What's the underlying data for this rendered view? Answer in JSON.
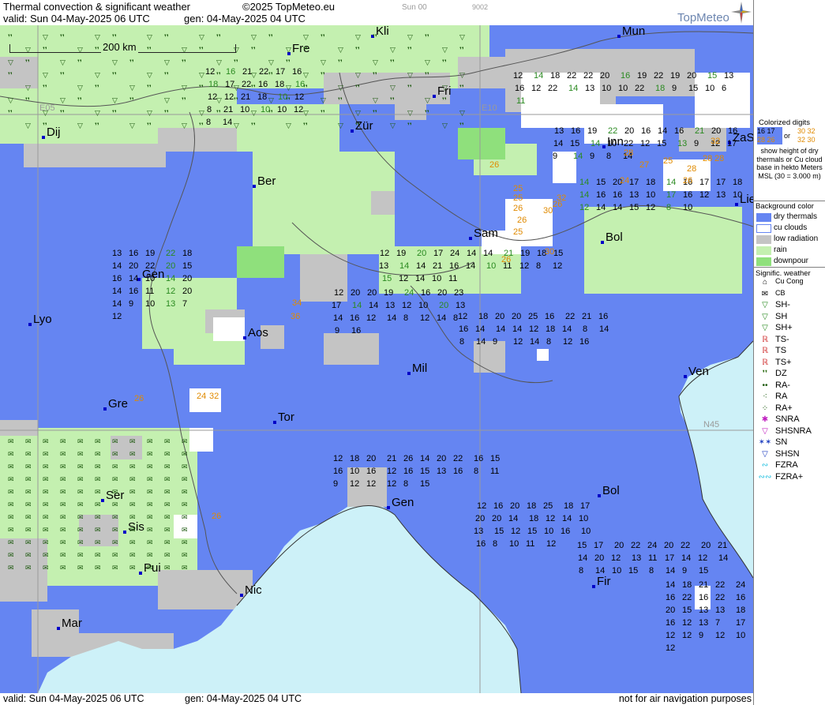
{
  "header": {
    "title": "Thermal convection & significant weather",
    "copyright": "©2025 TopMeteo.eu",
    "valid": "valid:  Sun  04-May-2025  06 UTC",
    "gen": "gen:  04-May-2025  04 UTC",
    "small_tag": "Sun 00",
    "small_code": "9002",
    "logo": "TopMeteo"
  },
  "footer": {
    "valid": "valid:  Sun  04-May-2025  06 UTC",
    "gen": "gen:  04-May-2025  04 UTC",
    "disclaimer": "not for air navigation purposes"
  },
  "map": {
    "scale_label": "200 km",
    "grid_labels": [
      {
        "id": "e05",
        "text": "E05"
      },
      {
        "id": "e10",
        "text": "E10"
      },
      {
        "id": "n45",
        "text": "N45"
      }
    ],
    "cities": [
      {
        "name": "Kli"
      },
      {
        "name": "Mun"
      },
      {
        "name": "Fre"
      },
      {
        "name": "Fri"
      },
      {
        "name": "Dij"
      },
      {
        "name": "Zür"
      },
      {
        "name": "Inn"
      },
      {
        "name": "ZaS"
      },
      {
        "name": "Ber"
      },
      {
        "name": "Lie"
      },
      {
        "name": "Sam"
      },
      {
        "name": "Bol"
      },
      {
        "name": "Gen"
      },
      {
        "name": "Lyo"
      },
      {
        "name": "Aos"
      },
      {
        "name": "Mil"
      },
      {
        "name": "Ven"
      },
      {
        "name": "Gre"
      },
      {
        "name": "Tor"
      },
      {
        "name": "Gen"
      },
      {
        "name": "Bol"
      },
      {
        "name": "Ser"
      },
      {
        "name": "Sis"
      },
      {
        "name": "Pui"
      },
      {
        "name": "Nic"
      },
      {
        "name": "Fir"
      },
      {
        "name": "Mar"
      }
    ],
    "numbers": [
      "12",
      "13",
      "14",
      "12",
      "12",
      "12",
      "12",
      "12",
      "15",
      "14",
      "12",
      "13",
      "14",
      "16",
      "15",
      "19",
      "20",
      "18",
      "18",
      "16",
      "17",
      "18",
      "16",
      "16",
      "18",
      "19",
      "20",
      "20",
      "20",
      "20",
      "20",
      "20",
      "20",
      "21",
      "21",
      "19",
      "22",
      "22",
      "17",
      "17",
      "19",
      "20",
      "21",
      "18",
      "22",
      "22",
      "22",
      "22",
      "22",
      "20",
      "18",
      "24",
      "24",
      "25",
      "26",
      "25",
      "24",
      "24",
      "17",
      "18",
      "20",
      "16",
      "14",
      "14",
      "16",
      "16",
      "14",
      "18",
      "20",
      "16",
      "16",
      "14",
      "16",
      "14",
      "16",
      "14",
      "20",
      "22",
      "20",
      "17",
      "22",
      "22",
      "18",
      "20",
      "19",
      "16",
      "17",
      "21",
      "23",
      "21",
      "22",
      "20",
      "20",
      "16",
      "17",
      "22",
      "22",
      "21",
      "17",
      "19",
      "17",
      "16",
      "16",
      "20",
      "21",
      "22",
      "22",
      "20",
      "19",
      "20",
      "18",
      "18",
      "14",
      "16",
      "15",
      "14",
      "14",
      "16",
      "16",
      "15",
      "20",
      "16",
      "14",
      "15",
      "14",
      "14",
      "16",
      "18",
      "20",
      "20",
      "18",
      "16",
      "15",
      "14",
      "16",
      "13",
      "13",
      "14",
      "10",
      "12",
      "12",
      "15",
      "16",
      "14",
      "13",
      "15",
      "16",
      "14",
      "12",
      "14",
      "16",
      "14",
      "13",
      "13",
      "12",
      "10",
      "16",
      "14",
      "13",
      "14",
      "10",
      "12",
      "12",
      "10",
      "11",
      "13",
      "12",
      "14",
      "12",
      "10",
      "10",
      "21",
      "20",
      "18",
      "16",
      "13",
      "17",
      "18",
      "21",
      "20",
      "22",
      "22",
      "17",
      "16",
      "13",
      "14",
      "15",
      "15",
      "14",
      "16",
      "18",
      "14",
      "14",
      "12",
      "16",
      "14",
      "14",
      "8",
      "13",
      "12",
      "12",
      "12",
      "10",
      "16",
      "13",
      "15",
      "12",
      "10",
      "16",
      "14",
      "16",
      "15",
      "14",
      "13",
      "12",
      "11",
      "10",
      "13",
      "13",
      "11",
      "12",
      "8",
      "8",
      "10",
      "8",
      "7",
      "8",
      "12",
      "10",
      "9",
      "10",
      "12",
      "14",
      "14",
      "11",
      "16",
      "14",
      "17",
      "21",
      "20",
      "22",
      "12",
      "12",
      "8",
      "8",
      "9",
      "9",
      "10",
      "10",
      "12",
      "10",
      "14",
      "18",
      "17",
      "14",
      "12",
      "12",
      "12",
      "12",
      "16",
      "15",
      "12",
      "10",
      "9",
      "9",
      "9",
      "14",
      "15",
      "14",
      "14",
      "12",
      "8",
      "8",
      "9",
      "10",
      "10",
      "15",
      "14",
      "15",
      "12",
      "8",
      "8",
      "12",
      "10",
      "14",
      "12",
      "12",
      "13",
      "10",
      "9",
      "12",
      "14",
      "9",
      "12",
      "8",
      "11",
      "9",
      "10",
      "8",
      "7",
      "6",
      "8",
      "8",
      "10",
      "16",
      "16",
      "15",
      "12",
      "15",
      "12",
      "14",
      "12",
      "11",
      "14",
      "10",
      "11"
    ],
    "warm_numbers": [
      "26",
      "25",
      "26",
      "28",
      "27",
      "25",
      "26",
      "24",
      "26",
      "32",
      "30",
      "34",
      "36",
      "26",
      "24",
      "32",
      "26",
      "25",
      "26",
      "25",
      "26",
      "30",
      "28",
      "28",
      "28",
      "32"
    ]
  },
  "legend": {
    "colorized_digits_title": "Colorized digits",
    "sample_a": "16 17",
    "sample_or": "or",
    "sample_b": "30 32",
    "sample_c": "28 26",
    "sample_d": "32 30",
    "colorized_desc": "show height of dry thermals or Cu cloud base in hekto Meters MSL (30 = 3.000 m)",
    "background_title": "Background color",
    "background_items": [
      {
        "label": "dry thermals",
        "color": "#6585f2"
      },
      {
        "label": "cu clouds",
        "color": "#ffffff"
      },
      {
        "label": "low radiation",
        "color": "#c4c4c4"
      },
      {
        "label": "rain",
        "color": "#c4f0b0"
      },
      {
        "label": "downpour",
        "color": "#8fe07c"
      }
    ],
    "weather_title": "Signific. weather",
    "weather_items": [
      {
        "label": "Cu Cong",
        "icon": "cu-cong-icon"
      },
      {
        "label": "CB",
        "icon": "cb-icon"
      },
      {
        "label": "SH-",
        "icon": "shower-light-icon"
      },
      {
        "label": "SH",
        "icon": "shower-icon"
      },
      {
        "label": "SH+",
        "icon": "shower-heavy-icon"
      },
      {
        "label": "TS-",
        "icon": "thunderstorm-light-icon"
      },
      {
        "label": "TS",
        "icon": "thunderstorm-icon"
      },
      {
        "label": "TS+",
        "icon": "thunderstorm-heavy-icon"
      },
      {
        "label": "DZ",
        "icon": "drizzle-icon"
      },
      {
        "label": "RA-",
        "icon": "rain-light-icon"
      },
      {
        "label": "RA",
        "icon": "rain-icon"
      },
      {
        "label": "RA+",
        "icon": "rain-heavy-icon"
      },
      {
        "label": "SNRA",
        "icon": "snow-rain-icon"
      },
      {
        "label": "SHSNRA",
        "icon": "snow-rain-shower-icon"
      },
      {
        "label": "SN",
        "icon": "snow-icon"
      },
      {
        "label": "SHSN",
        "icon": "snow-shower-icon"
      },
      {
        "label": "FZRA",
        "icon": "freezing-rain-icon"
      },
      {
        "label": "FZRA+",
        "icon": "freezing-rain-heavy-icon"
      }
    ],
    "colors": {
      "dry": "#6585f2",
      "cu": "#ffffff",
      "low": "#c4c4c4",
      "rain": "#c4f0b0",
      "downpour": "#8fe07c",
      "sea": "#cdf1f8",
      "green_text": "#2a8a20",
      "orange_text": "#e08a00",
      "thunder": "#d03030",
      "snow": "#c020c0",
      "freezing": "#20c0e0"
    }
  }
}
